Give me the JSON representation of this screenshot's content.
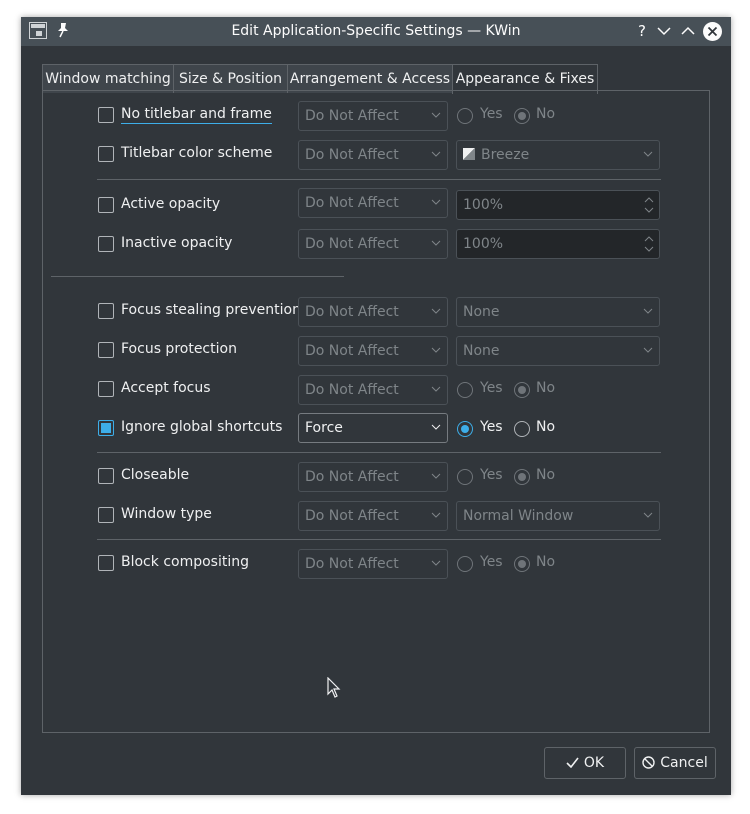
{
  "window": {
    "title": "Edit Application-Specific Settings — KWin",
    "help_glyph": "?"
  },
  "tabs": [
    {
      "label": "Window matching"
    },
    {
      "label": "Size & Position"
    },
    {
      "label": "Arrangement & Access"
    },
    {
      "label": "Appearance & Fixes",
      "active": true
    }
  ],
  "rows": {
    "no_titlebar": {
      "label": "No titlebar and frame",
      "policy": "Do Not Affect",
      "yes": "Yes",
      "no": "No"
    },
    "titlebar_color": {
      "label": "Titlebar color scheme",
      "policy": "Do Not Affect",
      "value": "Breeze"
    },
    "active_opacity": {
      "label": "Active opacity",
      "policy": "Do Not Affect",
      "value": "100%"
    },
    "inactive_opacity": {
      "label": "Inactive opacity",
      "policy": "Do Not Affect",
      "value": "100%"
    },
    "focus_stealing": {
      "label": "Focus stealing prevention",
      "policy": "Do Not Affect",
      "value": "None"
    },
    "focus_protection": {
      "label": "Focus protection",
      "policy": "Do Not Affect",
      "value": "None"
    },
    "accept_focus": {
      "label": "Accept focus",
      "policy": "Do Not Affect",
      "yes": "Yes",
      "no": "No"
    },
    "ignore_shortcuts": {
      "label": "Ignore global shortcuts",
      "checked": true,
      "policy": "Force",
      "yes": "Yes",
      "no": "No",
      "selected": "Yes"
    },
    "closeable": {
      "label": "Closeable",
      "policy": "Do Not Affect",
      "yes": "Yes",
      "no": "No"
    },
    "window_type": {
      "label": "Window type",
      "policy": "Do Not Affect",
      "value": "Normal Window"
    },
    "block_compositing": {
      "label": "Block compositing",
      "policy": "Do Not Affect",
      "yes": "Yes",
      "no": "No"
    }
  },
  "buttons": {
    "ok": "OK",
    "cancel": "Cancel"
  },
  "colors": {
    "accent": "#3daee9",
    "background": "#31363b",
    "titlebar": "#475057"
  }
}
